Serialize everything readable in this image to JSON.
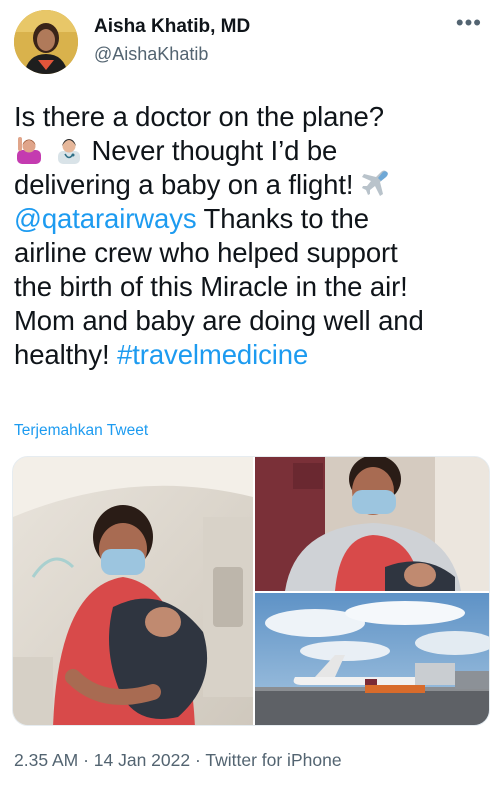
{
  "author": {
    "name": "Aisha Khatib, MD",
    "handle": "@AishaKhatib",
    "avatar_icon": "profile-photo"
  },
  "more_icon": "more-options-icon",
  "more_glyph": "•••",
  "tweet": {
    "line1": "Is there a doctor on the plane?",
    "line2_text": " Never thought I’d be",
    "line3_text": "delivering a baby on a flight! ",
    "line4_mention": "@qatarairways",
    "line4_text": " Thanks to the",
    "line5": "airline crew who helped support",
    "line6": "the birth of this Miracle in the air!",
    "line7": "Mom and baby are doing well and",
    "line8_text": "healthy! ",
    "line8_hashtag": "#travelmedicine",
    "emojis": [
      "raising-hand-emoji",
      "health-worker-emoji",
      "airplane-emoji"
    ]
  },
  "translate_label": "Terjemahkan Tweet",
  "media": {
    "photos": [
      "photo-doctor-holding-baby",
      "photo-selfie-with-baby",
      "photo-airplane-on-tarmac"
    ]
  },
  "meta": {
    "time": "2.35 AM",
    "sep1": " · ",
    "date": "14 Jan 2022",
    "sep2": " · ",
    "source": "Twitter for iPhone"
  },
  "colors": {
    "text": "#0f1419",
    "secondary": "#536471",
    "link": "#1d9bf0"
  }
}
